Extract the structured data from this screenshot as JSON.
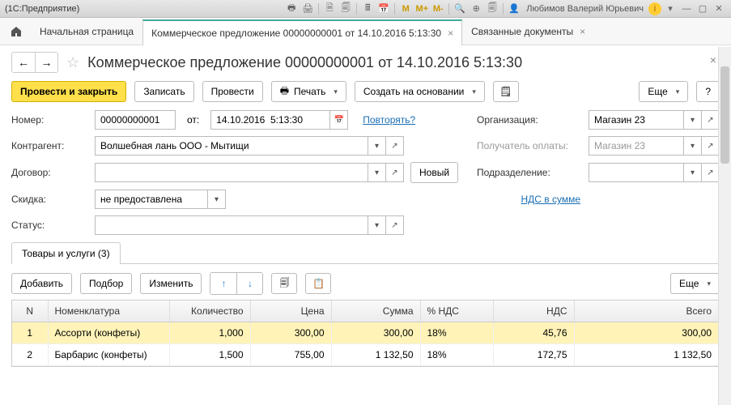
{
  "titlebar": {
    "app": "(1С:Предприятие)",
    "user": "Любимов Валерий Юрьевич"
  },
  "tabs": {
    "home": "Начальная страница",
    "t1": "Коммерческое предложение 00000000001 от 14.10.2016 5:13:30",
    "t2": "Связанные документы"
  },
  "page_title": "Коммерческое предложение 00000000001 от 14.10.2016 5:13:30",
  "toolbar": {
    "post_close": "Провести и закрыть",
    "save": "Записать",
    "post": "Провести",
    "print": "Печать",
    "create_based": "Создать на основании",
    "more": "Еще",
    "help": "?"
  },
  "form": {
    "number_label": "Номер:",
    "number_value": "00000000001",
    "from_label": "от:",
    "date_value": "14.10.2016  5:13:30",
    "repeat_link": "Повторять?",
    "org_label": "Организация:",
    "org_value": "Магазин 23",
    "counterparty_label": "Контрагент:",
    "counterparty_value": "Волшебная лань ООО - Мытищи",
    "payee_label": "Получатель оплаты:",
    "payee_value": "Магазин 23",
    "contract_label": "Договор:",
    "contract_value": "",
    "new_btn": "Новый",
    "division_label": "Подразделение:",
    "division_value": "",
    "discount_label": "Скидка:",
    "discount_value": "не предоставлена",
    "vat_link": "НДС в сумме",
    "status_label": "Статус:",
    "status_value": ""
  },
  "subtab": "Товары и услуги (3)",
  "table_toolbar": {
    "add": "Добавить",
    "select": "Подбор",
    "edit": "Изменить",
    "more": "Еще"
  },
  "table": {
    "headers": {
      "n": "N",
      "item": "Номенклатура",
      "qty": "Количество",
      "price": "Цена",
      "sum": "Сумма",
      "vat_pct": "% НДС",
      "vat": "НДС",
      "total": "Всего"
    },
    "rows": [
      {
        "n": "1",
        "item": "Ассорти (конфеты)",
        "qty": "1,000",
        "price": "300,00",
        "sum": "300,00",
        "vat_pct": "18%",
        "vat": "45,76",
        "total": "300,00",
        "selected": true
      },
      {
        "n": "2",
        "item": "Барбарис (конфеты)",
        "qty": "1,500",
        "price": "755,00",
        "sum": "1 132,50",
        "vat_pct": "18%",
        "vat": "172,75",
        "total": "1 132,50",
        "selected": false
      }
    ]
  }
}
